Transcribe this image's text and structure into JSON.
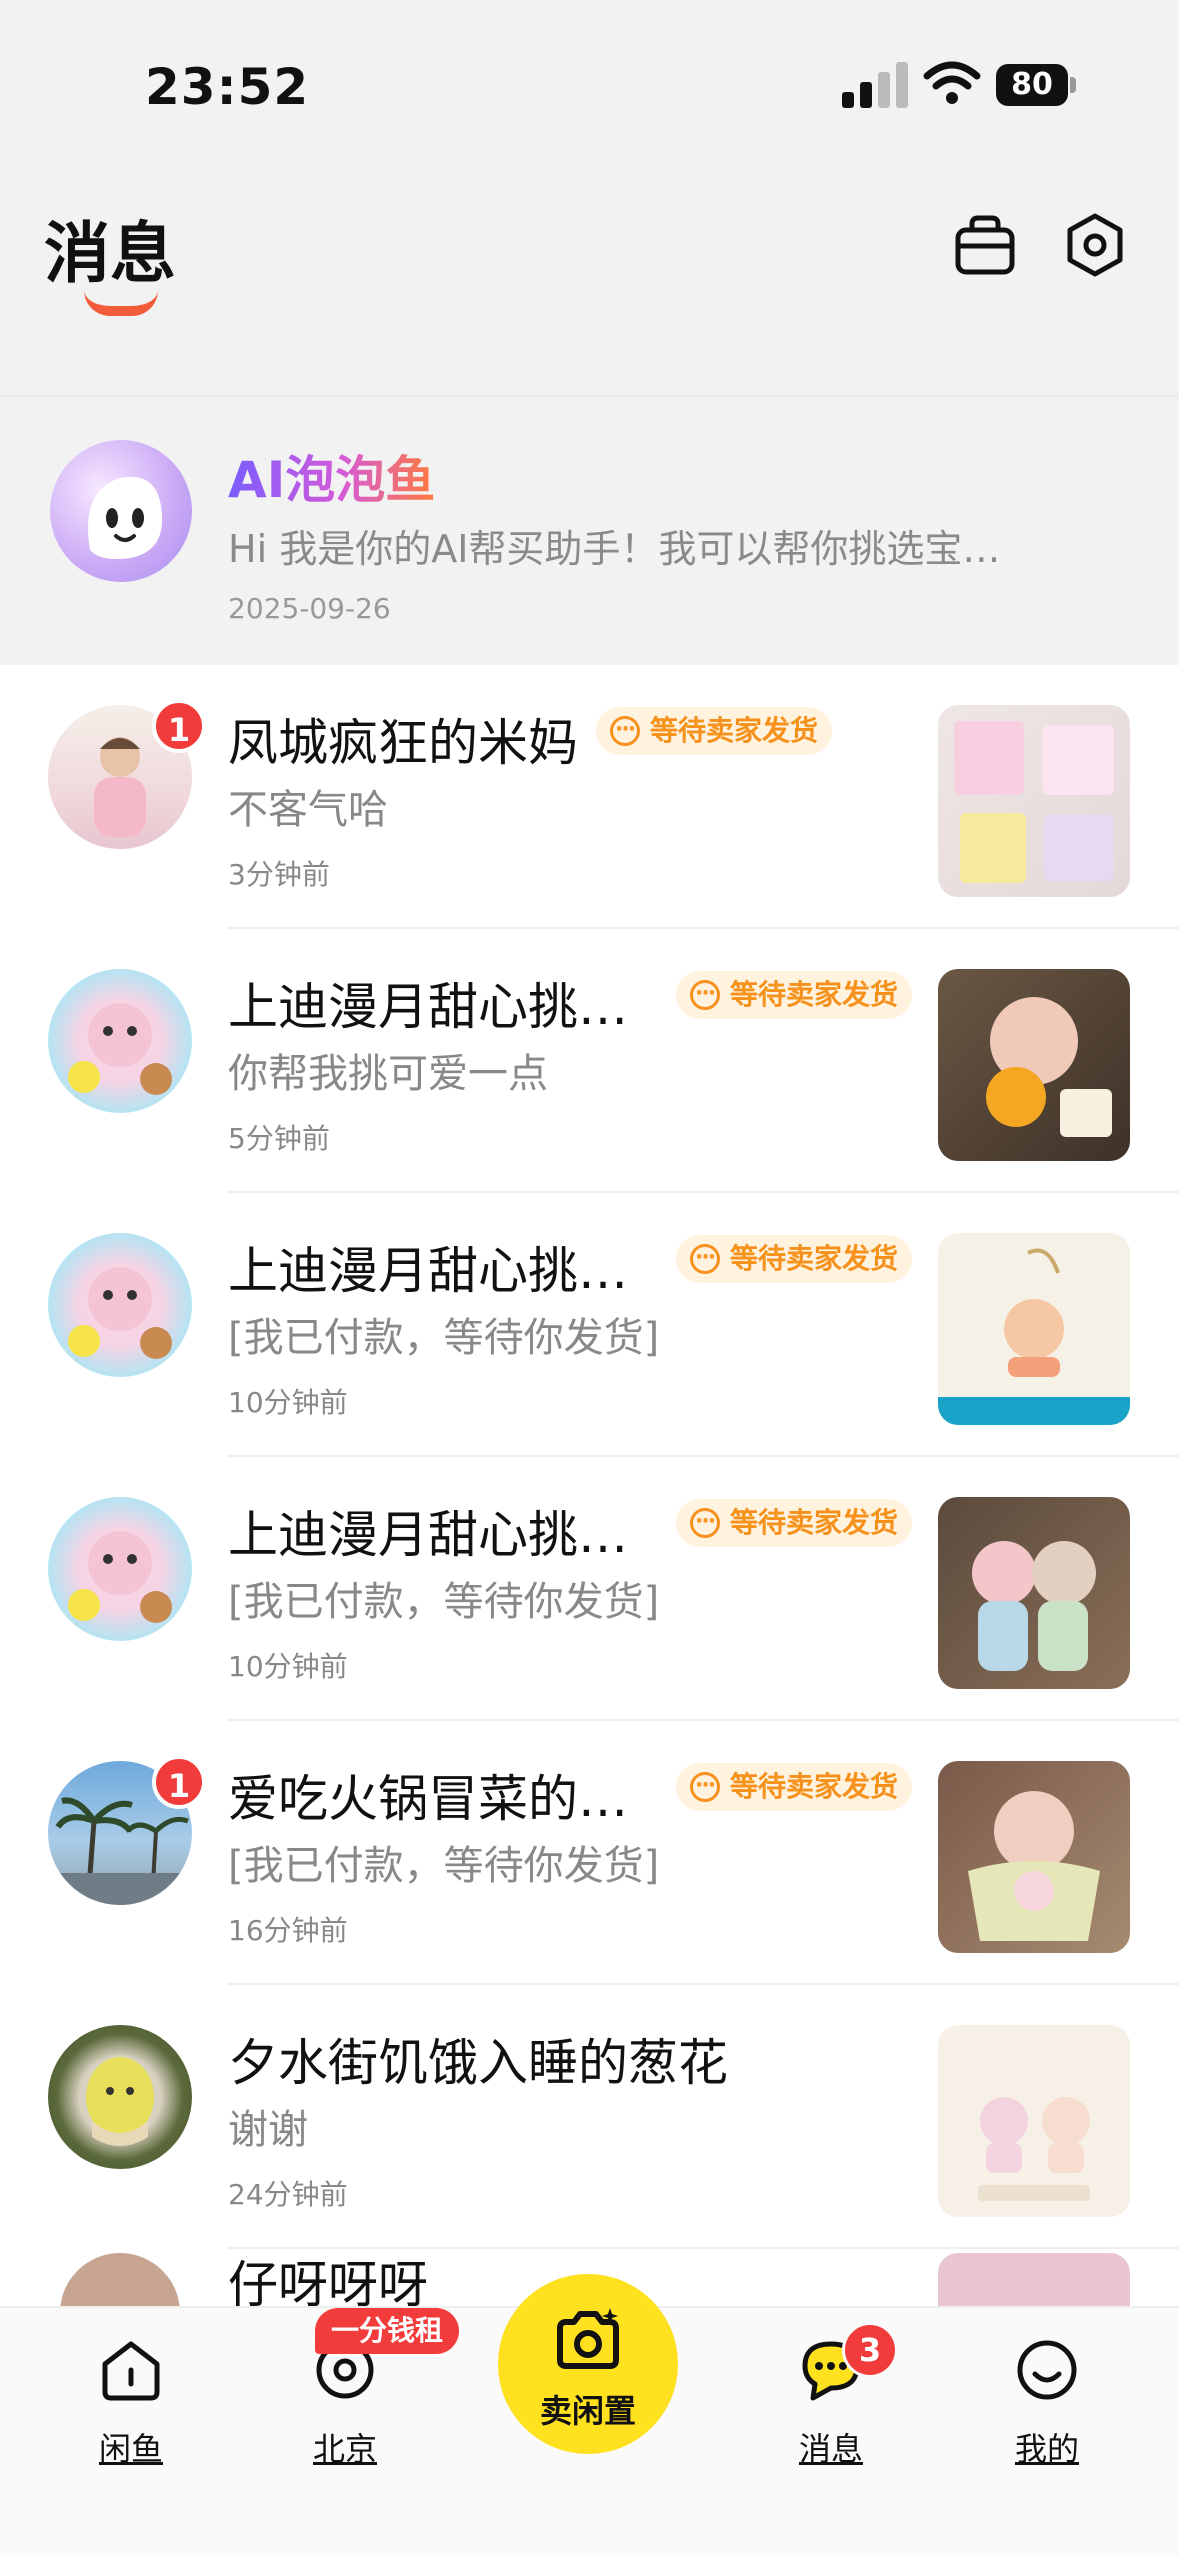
{
  "status_bar": {
    "time": "23:52",
    "battery": "80"
  },
  "header": {
    "title": "消息"
  },
  "ai_assistant": {
    "name": "AI泡泡鱼",
    "message": "Hi 我是你的AI帮买助手！我可以帮你挑选宝…",
    "date": "2025-09-26"
  },
  "conversations": [
    {
      "name": "凤城疯狂的米妈",
      "badge": "1",
      "status_tag": "等待卖家发货",
      "message": "不客气哈",
      "time": "3分钟前"
    },
    {
      "name": "上迪漫月甜心挑…",
      "badge": "",
      "status_tag": "等待卖家发货",
      "message": "你帮我挑可爱一点",
      "time": "5分钟前"
    },
    {
      "name": "上迪漫月甜心挑…",
      "badge": "",
      "status_tag": "等待卖家发货",
      "message": "[我已付款，等待你发货]",
      "time": "10分钟前"
    },
    {
      "name": "上迪漫月甜心挑…",
      "badge": "",
      "status_tag": "等待卖家发货",
      "message": "[我已付款，等待你发货]",
      "time": "10分钟前"
    },
    {
      "name": "爱吃火锅冒菜的…",
      "badge": "1",
      "status_tag": "等待卖家发货",
      "message": "[我已付款，等待你发货]",
      "time": "16分钟前"
    },
    {
      "name": "夕水街饥饿入睡的葱花",
      "badge": "",
      "status_tag": "",
      "message": "谢谢",
      "time": "24分钟前"
    }
  ],
  "partial_row": {
    "name": "仔呀呀呀"
  },
  "tab_bar": {
    "tabs": [
      {
        "label": "闲鱼",
        "icon": "home-icon"
      },
      {
        "label": "北京",
        "icon": "location-icon",
        "promo": "一分钱租"
      },
      {
        "label": "卖闲置",
        "icon": "camera-icon"
      },
      {
        "label": "消息",
        "icon": "chat-icon",
        "badge": "3"
      },
      {
        "label": "我的",
        "icon": "profile-icon"
      }
    ]
  },
  "colors": {
    "accent_yellow": "#ffe11f",
    "badge_red": "#f23b3b",
    "tag_orange": "#f6911b",
    "underline_orange": "#f25c3a"
  }
}
